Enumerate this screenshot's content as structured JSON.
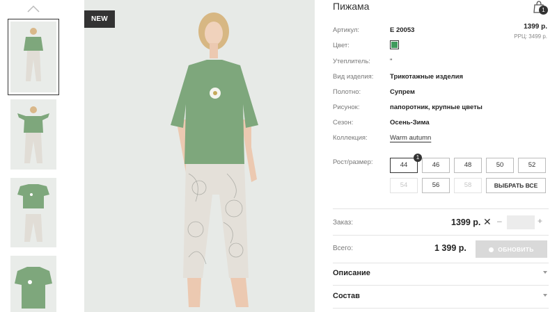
{
  "badge": "NEW",
  "product": {
    "title": "Пижама",
    "price": "1399 р.",
    "rrp": "РРЦ: 3499 р.",
    "swatch_color": "#3f9a5c"
  },
  "cart": {
    "count": "1",
    "icon": "shopping-bag-icon"
  },
  "attributes": [
    {
      "label": "Артикул:",
      "value": "Е 20053"
    },
    {
      "label": "Цвет:",
      "value": ""
    },
    {
      "label": "Утеплитель:",
      "value": "\""
    },
    {
      "label": "Вид изделия:",
      "value": "Трикотажные изделия"
    },
    {
      "label": "Полотно:",
      "value": "Супрем"
    },
    {
      "label": "Рисунок:",
      "value": "папоротник, крупные цветы"
    },
    {
      "label": "Сезон:",
      "value": "Осень-Зима"
    },
    {
      "label": "Коллекция:",
      "value": "Warm autumn"
    }
  ],
  "sizes": {
    "label": "Рост/размер:",
    "badge_count": "1",
    "row1": [
      "44",
      "46",
      "48",
      "50",
      "52"
    ],
    "row2": [
      "54",
      "56",
      "58"
    ],
    "select_all": "ВЫБРАТЬ ВСЕ",
    "selected": "44",
    "disabled": [
      "54",
      "58"
    ]
  },
  "order": {
    "label": "Заказ:",
    "price": "1399 р.",
    "times": "✕",
    "minus": "–",
    "plus": "+",
    "qty": ""
  },
  "total": {
    "label": "Всего:",
    "value": "1 399 р.",
    "button": "ОБНОВИТЬ"
  },
  "accordion": [
    {
      "label": "Описание"
    },
    {
      "label": "Состав"
    }
  ],
  "colors": {
    "shirt": "#7ea77c",
    "pants": "#e5e2dc",
    "bg": "#e8ebe8",
    "dark": "#333333"
  }
}
